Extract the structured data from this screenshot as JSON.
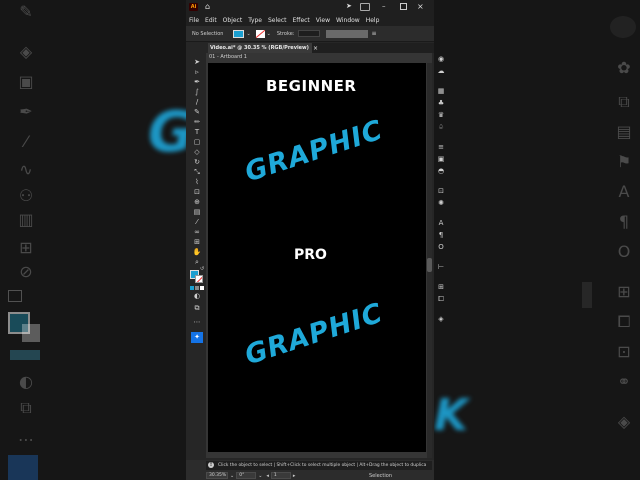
{
  "menu": [
    "File",
    "Edit",
    "Object",
    "Type",
    "Select",
    "Effect",
    "View",
    "Window",
    "Help"
  ],
  "app_logo": "Ai",
  "control_bar": {
    "selection_label": "No Selection",
    "stroke_label": "Stroke:",
    "fill_color": "#1b9fd0",
    "stroke_color": "#ffffff"
  },
  "document_tab": {
    "title": "Video.ai* @ 30.35 % (RGB/Preview)",
    "close": "×"
  },
  "artboard_label": "01 - Artboard 1",
  "artwork": {
    "line1": "BEGINNER",
    "line2": "GRAPHIC",
    "line3": "PRO",
    "line4": "GRAPHIC",
    "text_color_white": "#ffffff",
    "text_color_blue": "#1fa9d9"
  },
  "status": {
    "hint": "Click the object to select  |  Shift+Click to select multiple object  |  Alt+Drag the object to duplica",
    "zoom": "30.35%",
    "rotation": "0°",
    "artboard_number": "1",
    "tool_name": "Selection"
  },
  "colors": {
    "accent_blue": "#1b9fd0",
    "canvas_bg": "#353535",
    "ui_bg": "#262626",
    "selected_tool": "#1473e6"
  }
}
